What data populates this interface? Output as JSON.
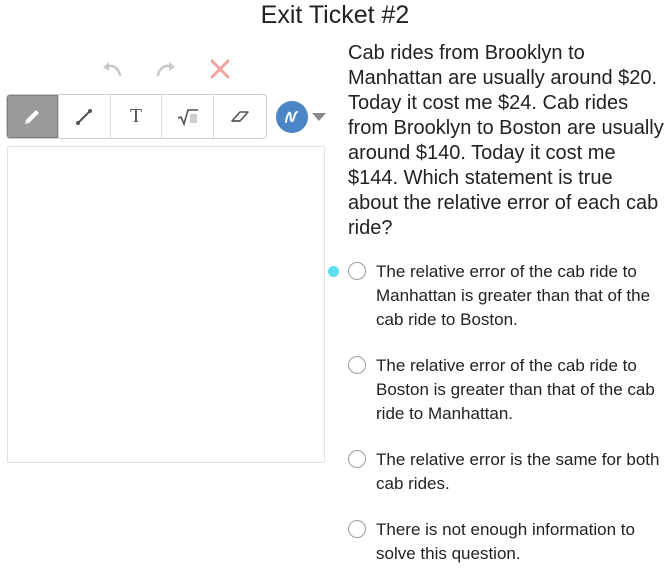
{
  "page": {
    "title": "Exit Ticket #2"
  },
  "drawing_tools": {
    "history": [
      {
        "name": "undo",
        "icon": "undo-icon"
      },
      {
        "name": "redo",
        "icon": "redo-icon"
      },
      {
        "name": "clear",
        "icon": "close-icon"
      }
    ],
    "tools": [
      {
        "name": "pencil",
        "icon": "pencil-icon",
        "active": true
      },
      {
        "name": "line",
        "icon": "line-icon",
        "active": false
      },
      {
        "name": "text",
        "label": "T",
        "icon": "text-icon",
        "active": false
      },
      {
        "name": "equation",
        "icon": "sqrt-icon",
        "active": false
      },
      {
        "name": "eraser",
        "icon": "eraser-icon",
        "active": false
      }
    ],
    "color": {
      "current": "#4a86c6",
      "icon": "scribble-icon"
    }
  },
  "question": {
    "prompt": "Cab rides from Brooklyn to Manhattan are usually around $20. Today it cost me $24. Cab rides from Brooklyn to Boston are usually around $140. Today it cost me $144.  Which statement is true about the relative error of each cab ride?",
    "choices": [
      {
        "label": "The relative error of the cab ride to Manhattan is greater than that of the cab ride to Boston.",
        "selected": false,
        "focused": true
      },
      {
        "label": "The relative error of the cab ride to Boston is greater than that of the cab ride to Manhattan.",
        "selected": false,
        "focused": false
      },
      {
        "label": "The relative error is the same for both cab rides.",
        "selected": false,
        "focused": false
      },
      {
        "label": "There is not enough information to solve this question.",
        "selected": false,
        "focused": false
      }
    ]
  },
  "colors": {
    "focus_indicator": "#5ce0f0",
    "active_tool_bg": "#9a9a9a",
    "clear_icon": "#f4a3a3",
    "history_icon": "#c8c8c8"
  }
}
